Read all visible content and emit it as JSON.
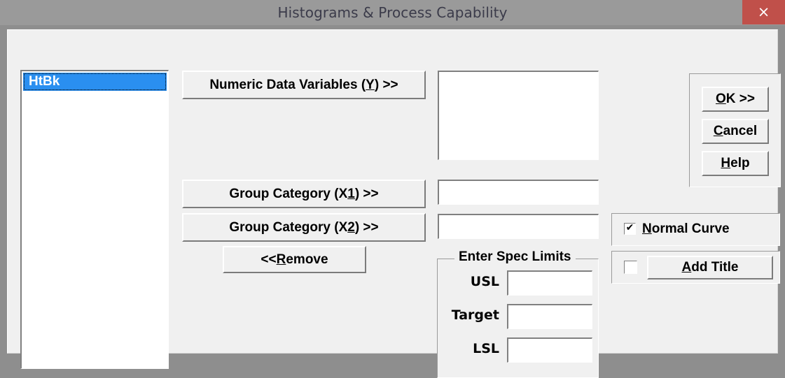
{
  "window": {
    "title": "Histograms & Process Capability",
    "close_label": "×",
    "close_icon": "close-icon"
  },
  "colors": {
    "titlebar": "#9a9a9a",
    "close_button": "#c0504a",
    "dialog_face": "#f0f0f0",
    "selection": "#2a8ff0",
    "window_border": "#8e8e8e"
  },
  "source_variables": {
    "items": [
      {
        "label": "HtBk",
        "selected": true
      }
    ]
  },
  "transfer_buttons": {
    "numeric_y": {
      "pre": "Numeric Data Variables (",
      "accel": "Y",
      "post": ") >>"
    },
    "group_x1": {
      "pre": "Group Category (X",
      "accel": "1",
      "post": ") >>"
    },
    "group_x2": {
      "pre": "Group Category (X",
      "accel": "2",
      "post": ") >>"
    },
    "remove": {
      "pre": "<< ",
      "accel": "R",
      "post": "emove"
    }
  },
  "targets": {
    "numeric_y_value": "",
    "group_x1_value": "",
    "group_x2_value": ""
  },
  "spec_limits": {
    "legend": "Enter Spec Limits",
    "fields": [
      {
        "label": "USL",
        "value": ""
      },
      {
        "label": "Target",
        "value": ""
      },
      {
        "label": "LSL",
        "value": ""
      }
    ]
  },
  "command_buttons": {
    "ok": {
      "pre": "",
      "accel": "O",
      "post": "K >>"
    },
    "cancel": {
      "pre": "",
      "accel": "C",
      "post": "ancel"
    },
    "help": {
      "pre": "",
      "accel": "H",
      "post": "elp"
    }
  },
  "options": {
    "normal_curve": {
      "checked": true,
      "check_glyph": "✔",
      "pre": "",
      "accel": "N",
      "post": "ormal Curve"
    },
    "add_title": {
      "checked": false,
      "check_glyph": "",
      "pre": "",
      "accel": "A",
      "post": "dd Title"
    }
  }
}
